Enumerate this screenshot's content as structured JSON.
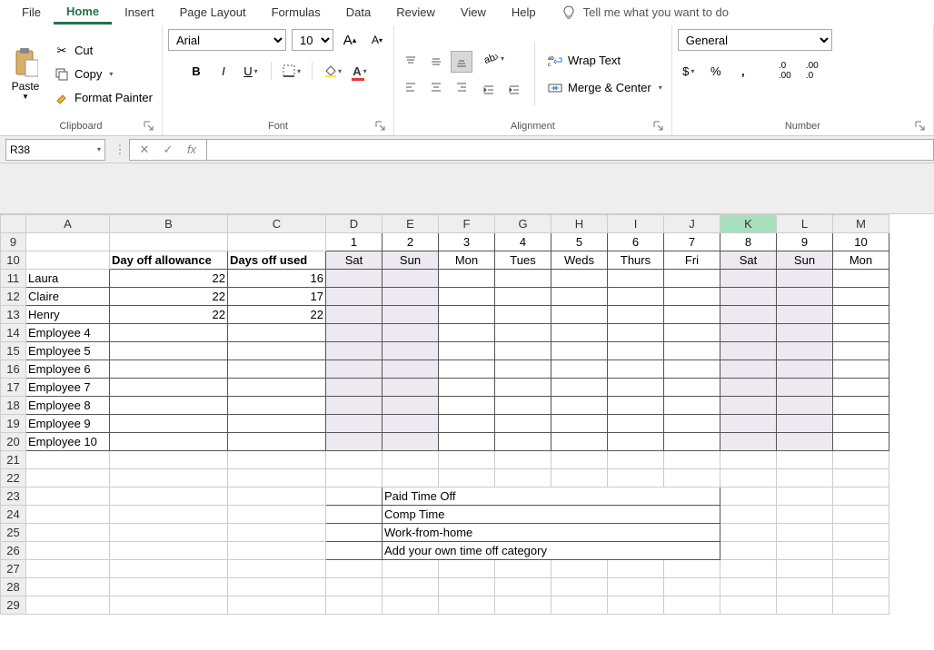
{
  "menu": {
    "items": [
      "File",
      "Home",
      "Insert",
      "Page Layout",
      "Formulas",
      "Data",
      "Review",
      "View",
      "Help"
    ],
    "active": "Home",
    "tellme": "Tell me what you want to do"
  },
  "ribbon": {
    "clipboard": {
      "label": "Clipboard",
      "paste": "Paste",
      "cut": "Cut",
      "copy": "Copy",
      "fmt": "Format Painter"
    },
    "font": {
      "label": "Font",
      "name": "Arial",
      "size": "10"
    },
    "alignment": {
      "label": "Alignment",
      "wrap": "Wrap Text",
      "merge": "Merge & Center"
    },
    "number": {
      "label": "Number",
      "format": "General"
    }
  },
  "fbar": {
    "ref": "R38",
    "fx": "fx"
  },
  "cols": {
    "A": "A",
    "B": "B",
    "C": "C",
    "D": "D",
    "E": "E",
    "F": "F",
    "G": "G",
    "H": "H",
    "I": "I",
    "J": "J",
    "K": "K",
    "L": "L",
    "M": "M"
  },
  "headers": {
    "allow": "Day off allowance",
    "used": "Days off used"
  },
  "days": {
    "nums": [
      "1",
      "2",
      "3",
      "4",
      "5",
      "6",
      "7",
      "8",
      "9",
      "10"
    ],
    "names": [
      "Sat",
      "Sun",
      "Mon",
      "Tues",
      "Weds",
      "Thurs",
      "Fri",
      "Sat",
      "Sun",
      "Mon"
    ]
  },
  "emp": [
    {
      "n": "Laura",
      "a": "22",
      "u": "16"
    },
    {
      "n": "Claire",
      "a": "22",
      "u": "17"
    },
    {
      "n": "Henry",
      "a": "22",
      "u": "22"
    },
    {
      "n": "Employee 4",
      "a": "",
      "u": ""
    },
    {
      "n": "Employee 5",
      "a": "",
      "u": ""
    },
    {
      "n": "Employee 6",
      "a": "",
      "u": ""
    },
    {
      "n": "Employee 7",
      "a": "",
      "u": ""
    },
    {
      "n": "Employee 8",
      "a": "",
      "u": ""
    },
    {
      "n": "Employee 9",
      "a": "",
      "u": ""
    },
    {
      "n": "Employee 10",
      "a": "",
      "u": ""
    }
  ],
  "legend": [
    {
      "c": "pink",
      "t": "Paid Time Off"
    },
    {
      "c": "teal",
      "t": "Comp Time"
    },
    {
      "c": "orange",
      "t": "Work-from-home"
    },
    {
      "c": "salmon",
      "t": "Add your own time off category"
    }
  ],
  "selcol": "K"
}
